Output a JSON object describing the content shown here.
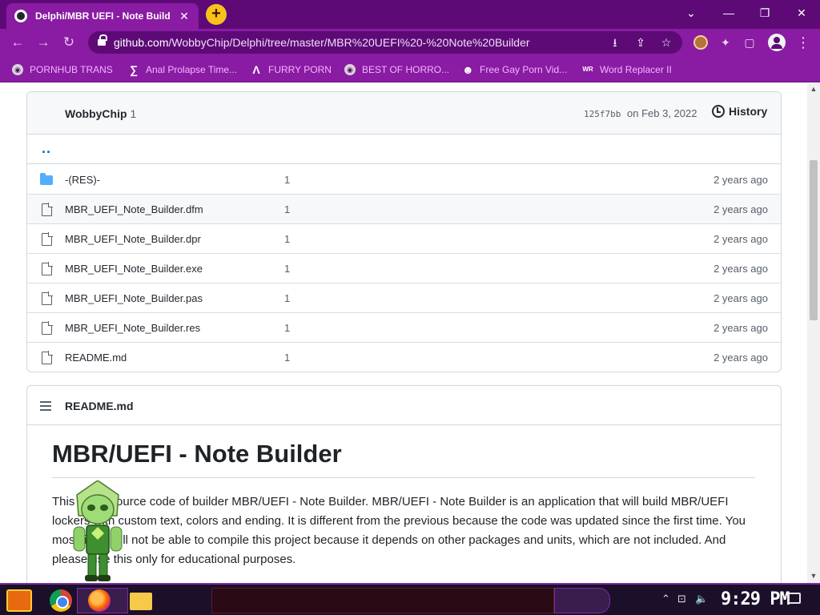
{
  "browser": {
    "tab_title": "Delphi/MBR UEFI - Note Build",
    "tab_close": "✕",
    "new_tab": "+",
    "window_controls": {
      "dropdown": "⌄",
      "minimize": "—",
      "restore": "❐",
      "close": "✕"
    },
    "url_host": "github.com",
    "url_path": "/WobbyChip/Delphi/tree/master/MBR%20UEFI%20-%20Note%20Builder",
    "nav": {
      "back": "←",
      "forward": "→",
      "reload": "↻"
    },
    "omnibox_icons": {
      "install": "⭳",
      "share": "⇪",
      "bookmark": "☆"
    },
    "extensions_icon": "✦",
    "sidepanel_icon": "▢",
    "menu_icon": "⋮"
  },
  "bookmarks": [
    {
      "label": "PORNHUB TRANS",
      "icon": "globe-icon",
      "glyph": "◉"
    },
    {
      "label": "Anal Prolapse Time...",
      "icon": "bookmark-icon",
      "glyph": "∑"
    },
    {
      "label": "FURRY PORN",
      "icon": "arrow-logo-icon",
      "glyph": "Λ"
    },
    {
      "label": "BEST OF HORRO...",
      "icon": "globe-icon",
      "glyph": "◉"
    },
    {
      "label": "Free Gay Porn Vid...",
      "icon": "bookmark-icon",
      "glyph": "☻"
    },
    {
      "label": "Word Replacer II",
      "icon": "wr-icon",
      "glyph": "WR"
    }
  ],
  "commit": {
    "author": "WobbyChip",
    "author_count": "1",
    "sha": "125f7bb",
    "date": "on Feb 3, 2022",
    "history_label": "History"
  },
  "parent_dir": "..",
  "files": [
    {
      "name": "-(RES)-",
      "type": "folder",
      "message": "1",
      "age": "2 years ago"
    },
    {
      "name": "MBR_UEFI_Note_Builder.dfm",
      "type": "file",
      "message": "1",
      "age": "2 years ago"
    },
    {
      "name": "MBR_UEFI_Note_Builder.dpr",
      "type": "file",
      "message": "1",
      "age": "2 years ago"
    },
    {
      "name": "MBR_UEFI_Note_Builder.exe",
      "type": "file",
      "message": "1",
      "age": "2 years ago"
    },
    {
      "name": "MBR_UEFI_Note_Builder.pas",
      "type": "file",
      "message": "1",
      "age": "2 years ago"
    },
    {
      "name": "MBR_UEFI_Note_Builder.res",
      "type": "file",
      "message": "1",
      "age": "2 years ago"
    },
    {
      "name": "README.md",
      "type": "file",
      "message": "1",
      "age": "2 years ago"
    }
  ],
  "readme": {
    "header": "README.md",
    "title": "MBR/UEFI - Note Builder",
    "paragraph": "This is the source code of builder MBR/UEFI - Note Builder. MBR/UEFI - Note Builder is an application that will build MBR/UEFI lockers with custom text, colors and ending. It is different from the previous because the code was updated since the first time. You most likely will not be able to compile this project because it depends on other packages and units, which are not included. And please use this only for educational purposes."
  },
  "taskbar": {
    "clock": "9:29 PM",
    "tray_chevron": "⌃",
    "tray_network": "⊡",
    "tray_volume": "🔈"
  },
  "colors": {
    "browser_frame": "#5d0a77",
    "toolbar": "#8a1ba3",
    "bookmark_text": "#f0b8ff",
    "folder_blue": "#54aeff",
    "github_link": "#0969da"
  }
}
